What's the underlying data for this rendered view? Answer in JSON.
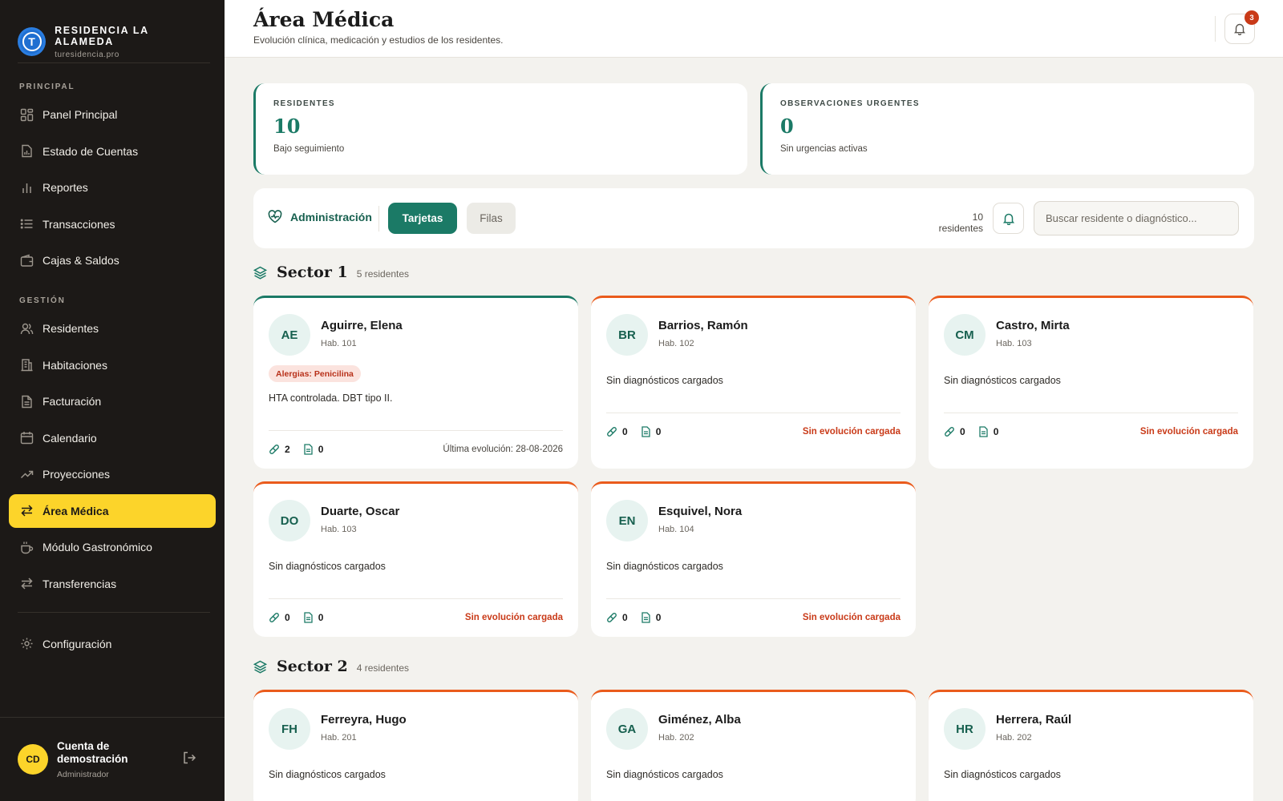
{
  "brand": {
    "name": "RESIDENCIA LA ALAMEDA",
    "domain": "turesidencia.pro",
    "logo_letter": "T",
    "color": "#1f6fd1"
  },
  "sidebar": {
    "section_principal": "PRINCIPAL",
    "section_gestion": "GESTIÓN",
    "principal_items": [
      {
        "label": "Panel Principal",
        "icon": "dashboard-icon"
      },
      {
        "label": "Estado de Cuentas",
        "icon": "document-chart-icon"
      },
      {
        "label": "Reportes",
        "icon": "bar-chart-icon"
      },
      {
        "label": "Transacciones",
        "icon": "list-icon"
      },
      {
        "label": "Cajas & Saldos",
        "icon": "wallet-icon"
      }
    ],
    "gestion_items": [
      {
        "label": "Residentes",
        "icon": "users-icon"
      },
      {
        "label": "Habitaciones",
        "icon": "building-icon"
      },
      {
        "label": "Facturación",
        "icon": "invoice-icon"
      },
      {
        "label": "Calendario",
        "icon": "calendar-icon"
      },
      {
        "label": "Proyecciones",
        "icon": "trend-up-icon"
      },
      {
        "label": "Área Médica",
        "icon": "transfer-icon",
        "active": true
      },
      {
        "label": "Módulo Gastronómico",
        "icon": "cup-icon"
      },
      {
        "label": "Transferencias",
        "icon": "transfer-icon"
      }
    ],
    "settings": {
      "label": "Configuración",
      "icon": "gear-icon"
    },
    "active_color": "#fcd42a"
  },
  "account": {
    "initials": "CD",
    "name": "Cuenta de demostración",
    "role": "Administrador"
  },
  "header": {
    "title": "Área Médica",
    "subtitle": "Evolución clínica, medicación y estudios de los residentes.",
    "notifications": "3"
  },
  "stats": [
    {
      "label": "RESIDENTES",
      "value": "10",
      "sub": "Bajo seguimiento"
    },
    {
      "label": "OBSERVACIONES URGENTES",
      "value": "0",
      "sub": "Sin urgencias activas"
    }
  ],
  "toolbar": {
    "admin_label": "Administración",
    "view_cards": "Tarjetas",
    "view_rows": "Filas",
    "count": "10 residentes",
    "search_placeholder": "Buscar residente o diagnóstico..."
  },
  "sectors": [
    {
      "title": "Sector 1",
      "count": "5 residentes",
      "cards": [
        {
          "initials": "AE",
          "name": "Aguirre, Elena",
          "room": "Hab. 101",
          "allergy": "Alergias: Penicilina",
          "diagnosis": "HTA controlada. DBT tipo II.",
          "meds": "2",
          "docs": "0",
          "status": "Última evolución: 28-08-2026",
          "ok": true
        },
        {
          "initials": "BR",
          "name": "Barrios, Ramón",
          "room": "Hab. 102",
          "diagnosis": "Sin diagnósticos cargados",
          "meds": "0",
          "docs": "0",
          "status": "Sin evolución cargada",
          "ok": false
        },
        {
          "initials": "CM",
          "name": "Castro, Mirta",
          "room": "Hab. 103",
          "diagnosis": "Sin diagnósticos cargados",
          "meds": "0",
          "docs": "0",
          "status": "Sin evolución cargada",
          "ok": false
        },
        {
          "initials": "DO",
          "name": "Duarte, Oscar",
          "room": "Hab. 103",
          "diagnosis": "Sin diagnósticos cargados",
          "meds": "0",
          "docs": "0",
          "status": "Sin evolución cargada",
          "ok": false
        },
        {
          "initials": "EN",
          "name": "Esquivel, Nora",
          "room": "Hab. 104",
          "diagnosis": "Sin diagnósticos cargados",
          "meds": "0",
          "docs": "0",
          "status": "Sin evolución cargada",
          "ok": false
        }
      ]
    },
    {
      "title": "Sector 2",
      "count": "4 residentes",
      "cards": [
        {
          "initials": "FH",
          "name": "Ferreyra, Hugo",
          "room": "Hab. 201",
          "diagnosis": "Sin diagnósticos cargados"
        },
        {
          "initials": "GA",
          "name": "Giménez, Alba",
          "room": "Hab. 202",
          "diagnosis": "Sin diagnósticos cargados"
        },
        {
          "initials": "HR",
          "name": "Herrera, Raúl",
          "room": "Hab. 202",
          "diagnosis": "Sin diagnósticos cargados"
        }
      ]
    }
  ],
  "colors": {
    "accent": "#1b7a66",
    "warning": "#ea5b1c",
    "sidebar_bg": "#1c1917"
  }
}
